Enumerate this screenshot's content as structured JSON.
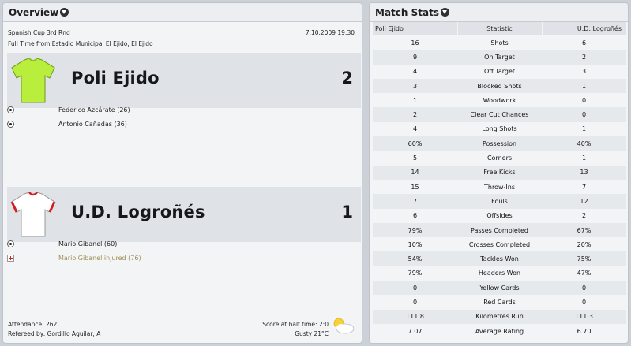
{
  "overview": {
    "title": "Overview",
    "competition": "Spanish Cup 3rd Rnd",
    "datetime": "7.10.2009 19:30",
    "venue_line": "Full Time from Estadio Municipal El Ejido, El Ejido",
    "home": {
      "name": "Poli Ejido",
      "score": "2",
      "shirt_color": "#b9ee3c",
      "events": [
        {
          "icon": "ball-icon",
          "text": "Federico Azcárate (26)"
        },
        {
          "icon": "ball-icon",
          "text": "Antonio Cañadas (36)"
        }
      ]
    },
    "away": {
      "name": "U.D. Logroñés",
      "score": "1",
      "shirt_color": "#ffffff",
      "trim_color": "#d21f1f",
      "events": [
        {
          "icon": "ball-icon",
          "text": "Mario Gibanel (60)"
        },
        {
          "icon": "injury-icon",
          "text": "Mario Gibanel injured (76)"
        }
      ]
    },
    "attendance": "Attendance: 262",
    "referee": "Refereed by: Gordillo Aguilar, A",
    "half_time": "Score at half time: 2:0",
    "weather": "Gusty 21°C",
    "weather_icon": "partly-cloudy-icon"
  },
  "match_stats": {
    "title": "Match Stats",
    "headers": {
      "home": "Poli Ejido",
      "stat": "Statistic",
      "away": "U.D. Logroñés"
    },
    "rows": [
      {
        "home": "16",
        "stat": "Shots",
        "away": "6"
      },
      {
        "home": "9",
        "stat": "On Target",
        "away": "2"
      },
      {
        "home": "4",
        "stat": "Off Target",
        "away": "3"
      },
      {
        "home": "3",
        "stat": "Blocked Shots",
        "away": "1"
      },
      {
        "home": "1",
        "stat": "Woodwork",
        "away": "0"
      },
      {
        "home": "2",
        "stat": "Clear Cut Chances",
        "away": "0"
      },
      {
        "home": "4",
        "stat": "Long Shots",
        "away": "1"
      },
      {
        "home": "60%",
        "stat": "Possession",
        "away": "40%"
      },
      {
        "home": "5",
        "stat": "Corners",
        "away": "1"
      },
      {
        "home": "14",
        "stat": "Free Kicks",
        "away": "13"
      },
      {
        "home": "15",
        "stat": "Throw-Ins",
        "away": "7"
      },
      {
        "home": "7",
        "stat": "Fouls",
        "away": "12"
      },
      {
        "home": "6",
        "stat": "Offsides",
        "away": "2"
      },
      {
        "home": "79%",
        "stat": "Passes Completed",
        "away": "67%"
      },
      {
        "home": "10%",
        "stat": "Crosses Completed",
        "away": "20%"
      },
      {
        "home": "54%",
        "stat": "Tackles Won",
        "away": "75%"
      },
      {
        "home": "79%",
        "stat": "Headers Won",
        "away": "47%"
      },
      {
        "home": "0",
        "stat": "Yellow Cards",
        "away": "0"
      },
      {
        "home": "0",
        "stat": "Red Cards",
        "away": "0"
      },
      {
        "home": "111.8",
        "stat": "Kilometres Run",
        "away": "111.3"
      },
      {
        "home": "7.07",
        "stat": "Average Rating",
        "away": "6.70"
      }
    ]
  }
}
